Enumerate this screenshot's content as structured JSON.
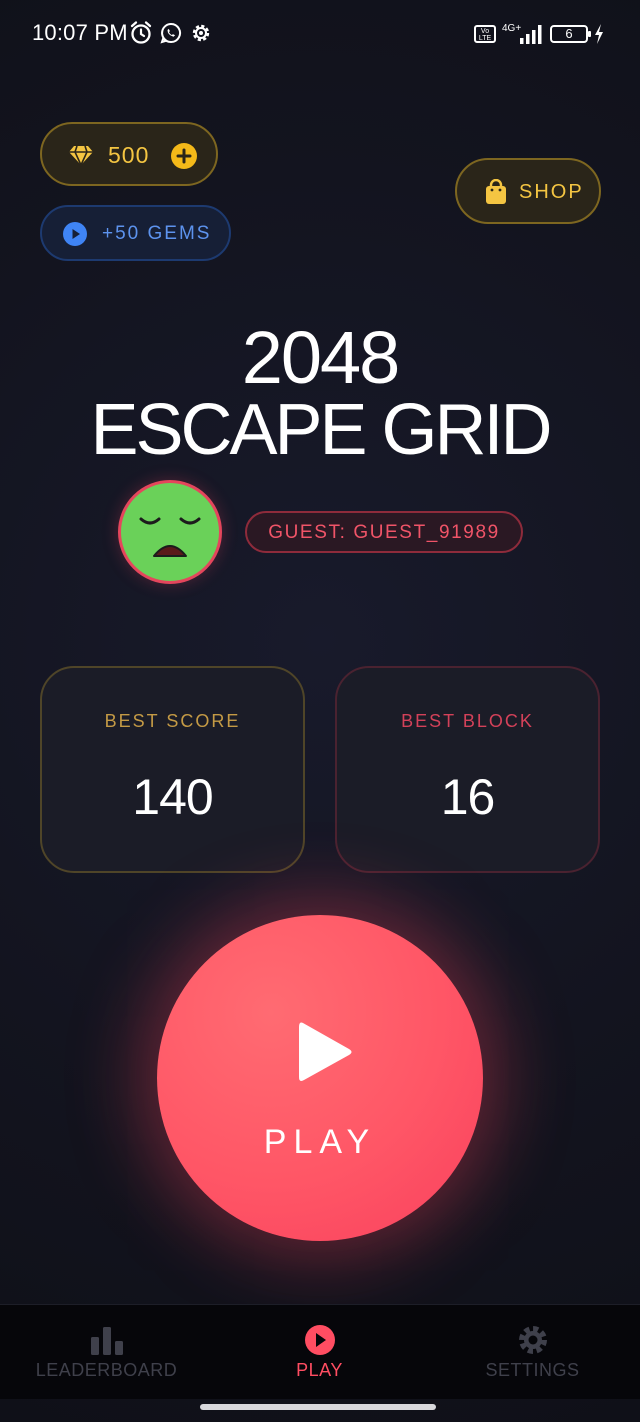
{
  "status_bar": {
    "time": "10:07 PM",
    "network": "4G+",
    "volte": "Vo LTE",
    "battery": "6",
    "icons": [
      "alarm-icon",
      "whatsapp-icon",
      "gear-icon",
      "volte-icon",
      "signal-icon",
      "battery-icon",
      "charging-icon"
    ]
  },
  "currency": {
    "gems": "500",
    "icon": "diamond-icon",
    "add_icon": "plus-icon"
  },
  "reward_ad": {
    "label": "+50 GEMS",
    "icon": "play-circle-icon"
  },
  "shop": {
    "label": "SHOP",
    "icon": "shopping-bag-icon"
  },
  "title": {
    "line1": "2048",
    "line2": "ESCAPE GRID"
  },
  "profile": {
    "avatar": "sad-face-avatar",
    "guest_label": "GUEST: GUEST_91989"
  },
  "stats": {
    "best_score_label": "BEST SCORE",
    "best_score_value": "140",
    "best_block_label": "BEST BLOCK",
    "best_block_value": "16"
  },
  "play_button": {
    "label": "PLAY",
    "icon": "play-icon"
  },
  "bottom_nav": {
    "items": [
      {
        "label": "LEADERBOARD",
        "icon": "bar-chart-icon",
        "active": false
      },
      {
        "label": "PLAY",
        "icon": "play-circle-icon",
        "active": true
      },
      {
        "label": "SETTINGS",
        "icon": "gear-icon",
        "active": false
      }
    ]
  },
  "colors": {
    "background": "#13141f",
    "accent": "#ff5666",
    "gold": "#f4c542",
    "blue": "#5d93ee",
    "avatar_green": "#6ad159"
  }
}
